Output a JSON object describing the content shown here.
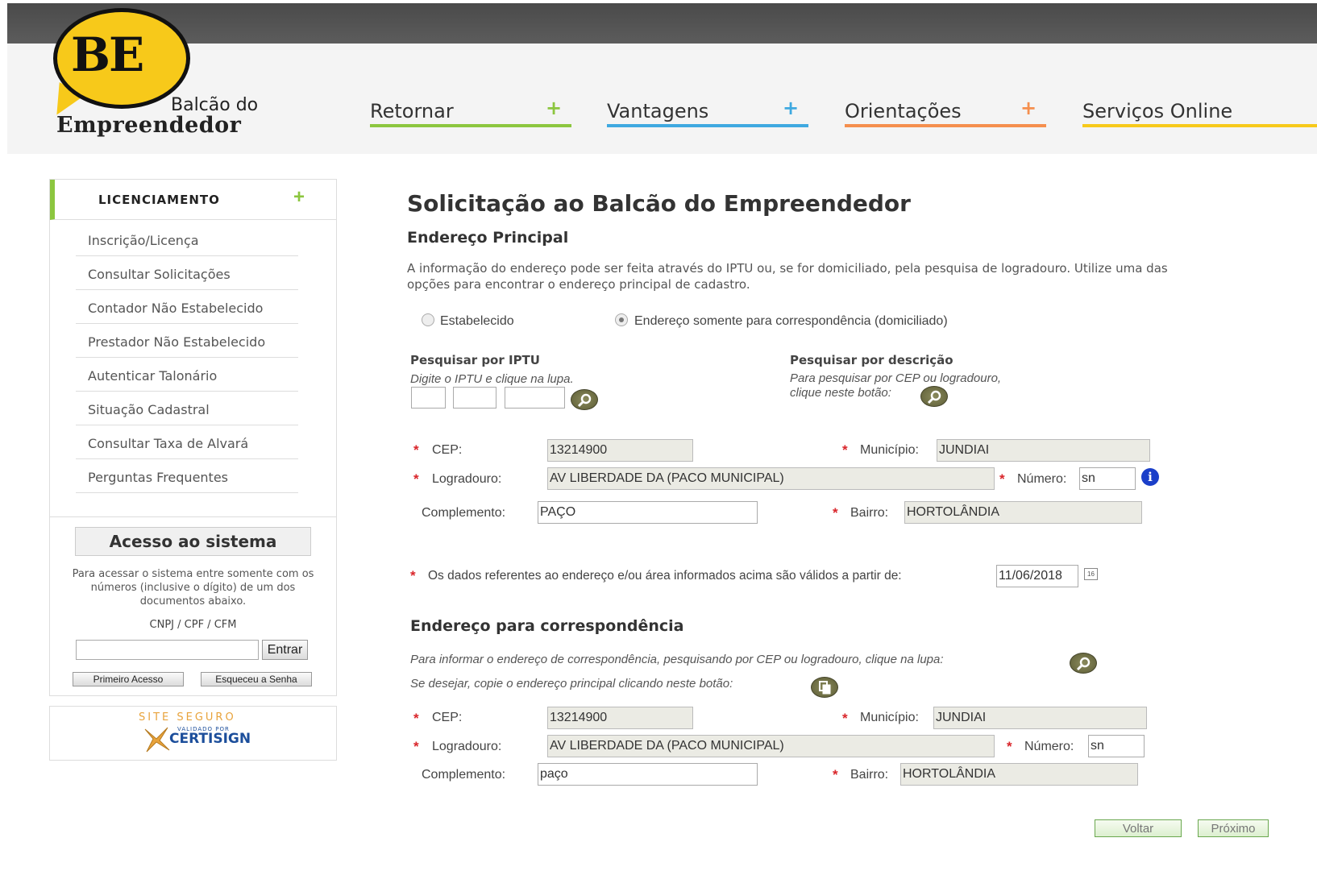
{
  "header": {
    "logo_mark": "BE",
    "logo_line1": "Balcão do",
    "logo_line2": "Empreendedor",
    "nav": [
      {
        "label": "Retornar",
        "plus": "+",
        "color": "#8cc63f"
      },
      {
        "label": "Vantagens",
        "plus": "+",
        "color": "#3fa9e0"
      },
      {
        "label": "Orientações",
        "plus": "+",
        "color": "#f58f4e"
      },
      {
        "label": "Serviços Online",
        "plus": "+",
        "color": "#f7c91a"
      }
    ]
  },
  "sidebar": {
    "section_title": "LICENCIAMENTO",
    "section_plus": "+",
    "items": [
      "Inscrição/Licença",
      "Consultar Solicitações",
      "Contador Não Estabelecido",
      "Prestador Não Estabelecido",
      "Autenticar Talonário",
      "Situação Cadastral",
      "Consultar Taxa de Alvará",
      "Perguntas Frequentes"
    ],
    "access": {
      "title": "Acesso ao sistema",
      "text": "Para acessar o sistema entre somente com os números (inclusive o dígito) de um dos documentos abaixo.",
      "docs": "CNPJ / CPF / CFM",
      "input_value": "",
      "enter_label": "Entrar",
      "first_access_label": "Primeiro Acesso",
      "forgot_label": "Esqueceu a Senha"
    },
    "seal": {
      "line1": "SITE SEGURO",
      "line2": "VALIDADO POR",
      "line3": "CERTISIGN"
    }
  },
  "main": {
    "title": "Solicitação ao Balcão do Empreendedor",
    "principal": {
      "heading": "Endereço Principal",
      "intro_line1": "A informação do endereço pode ser feita através do IPTU ou, se for domiciliado, pela pesquisa de logradouro. Utilize uma das",
      "intro_line2": "opções para encontrar o endereço principal de cadastro.",
      "radio_estabelecido": "Estabelecido",
      "radio_domiciliado": "Endereço somente para correspondência (domiciliado)",
      "selected_option": "domiciliado",
      "iptu_title": "Pesquisar por IPTU",
      "iptu_hint": "Digite o IPTU e clique na lupa.",
      "iptu_values": [
        "",
        "",
        ""
      ],
      "desc_title": "Pesquisar por descrição",
      "desc_hint_line1": "Para pesquisar por CEP ou logradouro,",
      "desc_hint_line2": "clique neste botão:",
      "cep_label": "CEP:",
      "cep": "13214900",
      "municipio_label": "Município:",
      "municipio": "JUNDIAI",
      "logradouro_label": "Logradouro:",
      "logradouro": "AV  LIBERDADE DA (PACO MUNICIPAL)",
      "numero_label": "Número:",
      "numero": "sn",
      "complemento_label": "Complemento:",
      "complemento": "PAÇO",
      "bairro_label": "Bairro:",
      "bairro": "HORTOLÂNDIA",
      "validity_text": "Os dados referentes ao endereço e/ou área informados acima são válidos a partir de:",
      "validity_date": "11/06/2018",
      "calendar_text": "16"
    },
    "correspondencia": {
      "heading": "Endereço para correspondência",
      "hint1": "Para informar o endereço de correspondência, pesquisando por CEP ou logradouro, clique na lupa:",
      "hint2": "Se desejar, copie o endereço principal clicando neste botão:",
      "cep_label": "CEP:",
      "cep": "13214900",
      "municipio_label": "Município:",
      "municipio": "JUNDIAI",
      "logradouro_label": "Logradouro:",
      "logradouro": "AV  LIBERDADE DA (PACO MUNICIPAL)",
      "numero_label": "Número:",
      "numero": "sn",
      "complemento_label": "Complemento:",
      "complemento": "paço",
      "bairro_label": "Bairro:",
      "bairro": "HORTOLÂNDIA"
    },
    "buttons": {
      "back": "Voltar",
      "next": "Próximo"
    },
    "required_mark": "*",
    "info_mark": "i"
  }
}
